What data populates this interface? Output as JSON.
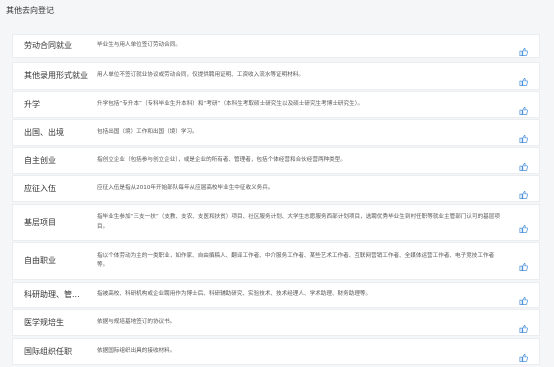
{
  "header": {
    "title": "其他去向登记"
  },
  "rows": [
    {
      "label": "劳动合同就业",
      "desc": "毕业生与用人单位签订劳动合同。"
    },
    {
      "label": "其他录用形式就业",
      "desc": "用人单位不签订就业协议或劳动合同，仅提供聘用证明、工资收入流水等证明材料。"
    },
    {
      "label": "升学",
      "desc": "升学包括“专升本”（专科毕业生升本科）和“考研”（本科生考取硕士研究生以及硕士研究生考博士研究生）。"
    },
    {
      "label": "出国、出境",
      "desc": "包括出国（境）工作和出国（境）学习。"
    },
    {
      "label": "自主创业",
      "desc": "指创立企业（包括参与创立企业），或是企业的所有者、管理者，包括个体经营和合伙经营两种类型。"
    },
    {
      "label": "应征入伍",
      "desc": "应征入伍是指从2010年开始部队每年从应届高校毕业生中征收义务兵。"
    },
    {
      "label": "基层项目",
      "desc": "指毕业生参加“三支一扶”（支教、支农、支医和扶贫）项目、社区服务计划、大学生志愿服务西部计划项目，选聘优秀毕业生到村任职等就业主管部门认可的基层项目。"
    },
    {
      "label": "自由职业",
      "desc": "指以个体劳动为主的一类职业，如作家、自由撰稿人、翻译工作者、中介服务工作者、某些艺术工作者、互联网营销工作者、全媒体运营工作者、电子竞技工作者等。"
    },
    {
      "label": "科研助理、管...",
      "desc": "指被高校、科研机构或企业聘用作为博士后、科研辅助研究、实验技术、技术经理人、学术助理、财务助理等。"
    },
    {
      "label": "医学规培生",
      "desc": "依据与规培基地签订的协议书。"
    },
    {
      "label": "国际组织任职",
      "desc": "依据国际组织出具的接收材料。"
    }
  ],
  "icons": {
    "row_action": "edit-icon"
  },
  "colors": {
    "icon": "#4a90d9",
    "background": "#f5f6f8",
    "card": "#ffffff"
  }
}
